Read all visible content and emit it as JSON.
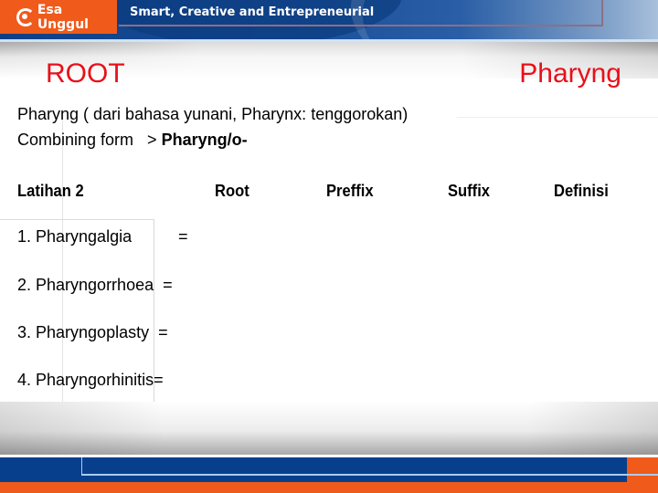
{
  "header": {
    "logo_text": "Esa Unggul",
    "tagline": "Smart, Creative and Entrepreneurial"
  },
  "slide": {
    "title_left": "ROOT",
    "title_right": "Pharyng",
    "line1": "Pharyng ( dari bahasa yunani, Pharynx: tenggorokan)",
    "line2_prefix": "Combining form   > ",
    "line2_bold": "Pharyng/o-",
    "columns": [
      "Latihan 2",
      "Root",
      "Preffix",
      "Suffix",
      "Definisi"
    ],
    "items": [
      "1. Pharyngalgia",
      "2. Pharyngorrhoea  =",
      "3. Pharyngoplasty  =",
      "4. Pharyngorhinitis="
    ],
    "item1_equals": "="
  },
  "colors": {
    "brand_orange": "#f05a1a",
    "brand_blue": "#073f8c",
    "title_red": "#e8101a"
  }
}
